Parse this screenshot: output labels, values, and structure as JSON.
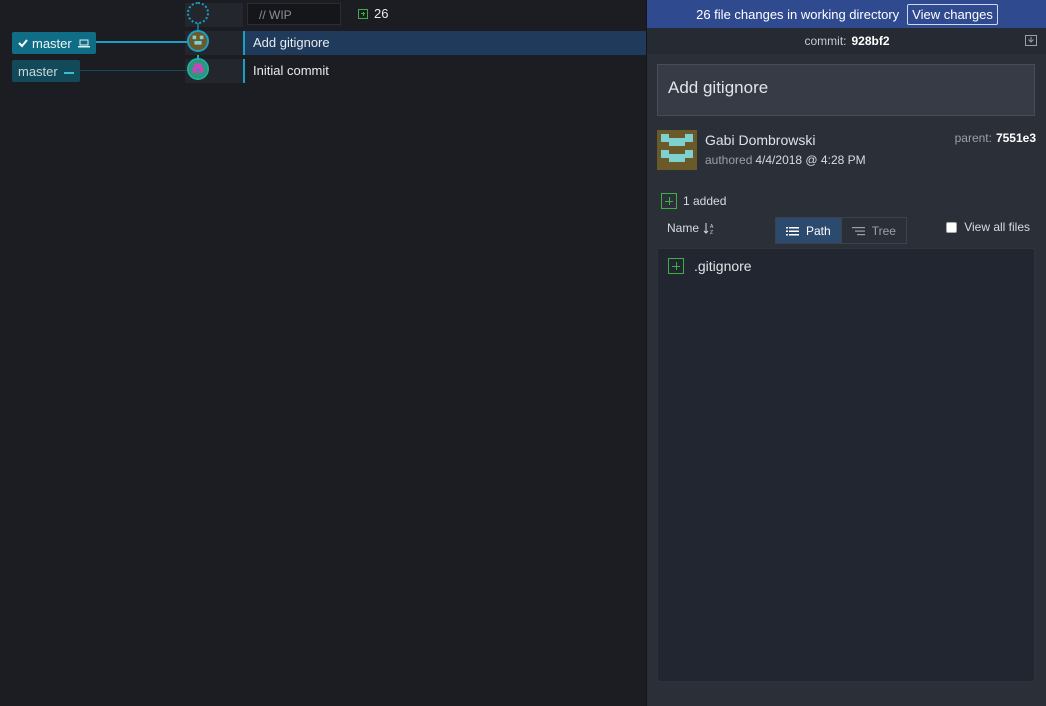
{
  "graph": {
    "wip": {
      "placeholder": "// WIP",
      "count": "26"
    },
    "commits": [
      {
        "branch": "master",
        "message": "Add gitignore",
        "selected": true
      },
      {
        "branch": "master",
        "message": "Initial commit",
        "selected": false
      }
    ]
  },
  "panel": {
    "banner": {
      "text": "26 file changes in working directory",
      "button": "View changes"
    },
    "commit_label": "commit:",
    "commit_sha": "928bf2",
    "summary": "Add gitignore",
    "author": "Gabi Dombrowski",
    "authored_label": "authored",
    "authored_date": "4/4/2018 @ 4:28 PM",
    "parent_label": "parent:",
    "parent_sha": "7551e3",
    "added": "1 added",
    "sort_label": "Name",
    "view_path": "Path",
    "view_tree": "Tree",
    "view_all_files": "View all files",
    "files": [
      ".gitignore"
    ]
  },
  "colors": {
    "accent": "#1c9fc7",
    "banner": "#2f4a8f",
    "selected_row": "#1f3a5a",
    "added_green": "#3fae49"
  }
}
